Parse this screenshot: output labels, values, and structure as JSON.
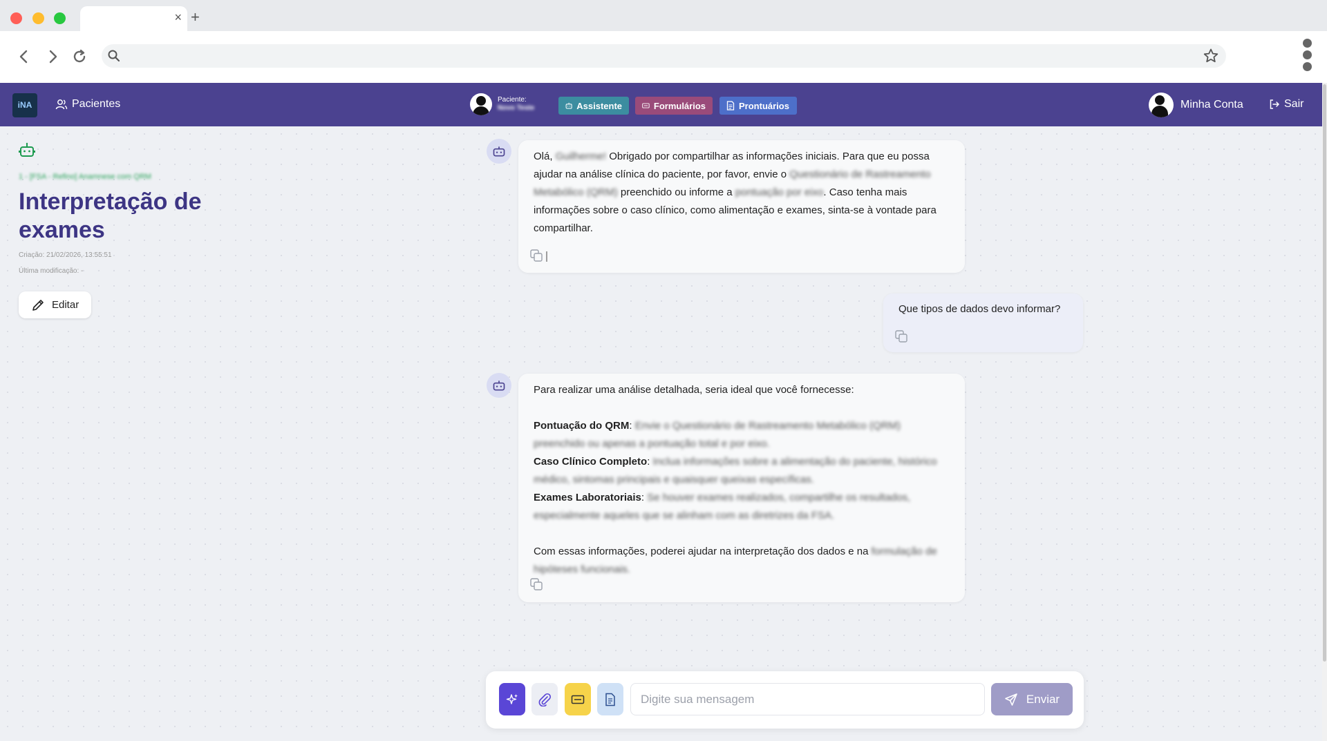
{
  "browser": {
    "tab_close": "×",
    "new_tab": "+",
    "address_value": ""
  },
  "header": {
    "logo_text": "iNA",
    "patients_label": "Pacientes",
    "patient_caption": "Paciente:",
    "patient_name": "Novo Teste",
    "assistant_label": "Assistente",
    "forms_label": "Formulários",
    "records_label": "Prontuários",
    "account_label": "Minha Conta",
    "logout_label": "Sair",
    "colors": {
      "bar": "#4b4290",
      "assistant": "#3c8da0",
      "forms": "#9a4b7a",
      "records": "#4d6fc9"
    }
  },
  "sidebar": {
    "breadcrumb": "1 - [FSA - Refino] Anamnese com QRM",
    "title": "Interpretação de exames",
    "created": "Criação: 21/02/2026, 13:55:51",
    "modified": "Última modificação: -",
    "edit_label": "Editar"
  },
  "chat": {
    "messages": [
      {
        "role": "assistant",
        "parts": [
          "Olá, ",
          "Guilherme!",
          " Obrigado por compartilhar as informações iniciais. Para que eu possa ajudar na análise clínica do paciente, por favor, envie o ",
          "Questionário de Rastreamento Metabólico (QRM)",
          " preenchido ou informe a ",
          "pontuação por eixo",
          ". Caso tenha mais informações sobre o caso clínico, como alimentação e exames, sinta-se à vontade para compartilhar."
        ]
      },
      {
        "role": "user",
        "text": "Que tipos de dados devo informar?"
      },
      {
        "role": "assistant",
        "intro": "Para realizar uma análise detalhada, seria ideal que você fornecesse:",
        "items": [
          {
            "label": "Pontuação do QRM",
            "text": "Envie o Questionário de Rastreamento Metabólico (QRM) preenchido ou apenas a pontuação total e por eixo."
          },
          {
            "label": "Caso Clínico Completo",
            "text": "Inclua informações sobre a alimentação do paciente, histórico médico, sintomas principais e quaisquer queixas específicas."
          },
          {
            "label": "Exames Laboratoriais",
            "text": "Se houver exames realizados, compartilhe os resultados, especialmente aqueles que se alinham com as diretrizes da FSA."
          }
        ],
        "outro": "Com essas informações, poderei ajudar na interpretação dos dados e na ",
        "outro_blur": "formulação de hipóteses funcionais."
      }
    ]
  },
  "composer": {
    "placeholder": "Digite sua mensagem",
    "value": "",
    "send_label": "Enviar"
  }
}
